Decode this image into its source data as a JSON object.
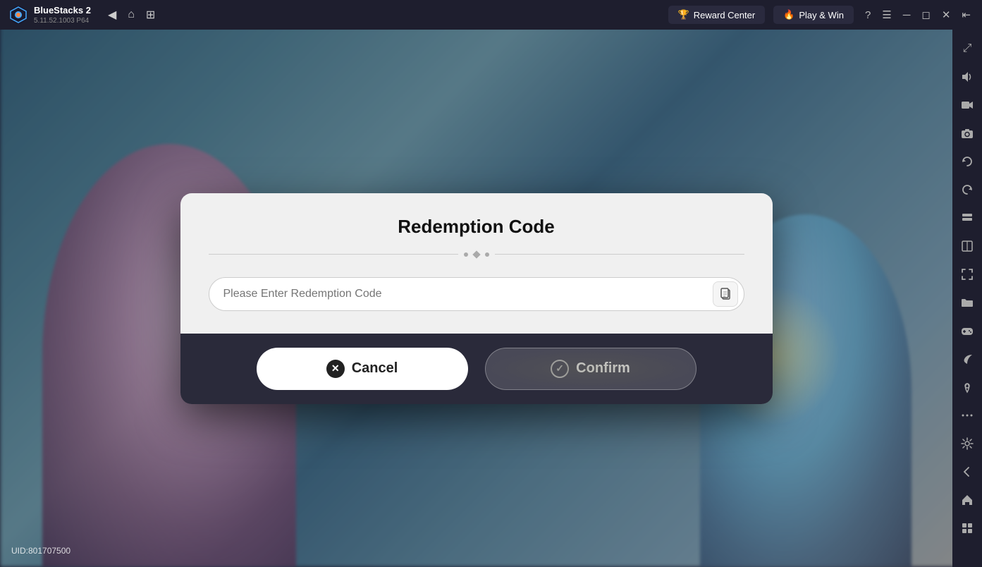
{
  "titlebar": {
    "app_name": "BlueStacks 2",
    "version": "5.11.52.1003  P64",
    "reward_btn": "Reward Center",
    "play_btn": "Play & Win",
    "nav": {
      "back": "◀",
      "home": "⌂",
      "grid": "⊞"
    }
  },
  "sidebar": {
    "icons": [
      {
        "name": "fullscreen-icon",
        "symbol": "⤢"
      },
      {
        "name": "volume-icon",
        "symbol": "🔊"
      },
      {
        "name": "video-icon",
        "symbol": "▶"
      },
      {
        "name": "camera-icon",
        "symbol": "📷"
      },
      {
        "name": "rotate-icon",
        "symbol": "↻"
      },
      {
        "name": "rotate2-icon",
        "symbol": "↺"
      },
      {
        "name": "layers-icon",
        "symbol": "⊞"
      },
      {
        "name": "book-icon",
        "symbol": "📖"
      },
      {
        "name": "screenshot-icon",
        "symbol": "📷"
      },
      {
        "name": "folder-icon",
        "symbol": "📁"
      },
      {
        "name": "gamepad-icon",
        "symbol": "🎮"
      },
      {
        "name": "eco-icon",
        "symbol": "♻"
      },
      {
        "name": "pin-icon",
        "symbol": "📍"
      },
      {
        "name": "more-icon",
        "symbol": "···"
      },
      {
        "name": "settings-icon",
        "symbol": "⚙"
      },
      {
        "name": "back-icon",
        "symbol": "←"
      },
      {
        "name": "home-sidebar-icon",
        "symbol": "⌂"
      },
      {
        "name": "apps-icon",
        "symbol": "⊞"
      }
    ]
  },
  "dialog": {
    "title": "Redemption Code",
    "input_placeholder": "Please Enter Redemption Code",
    "cancel_label": "Cancel",
    "confirm_label": "Confirm"
  },
  "footer": {
    "uid": "UID:801707500"
  }
}
